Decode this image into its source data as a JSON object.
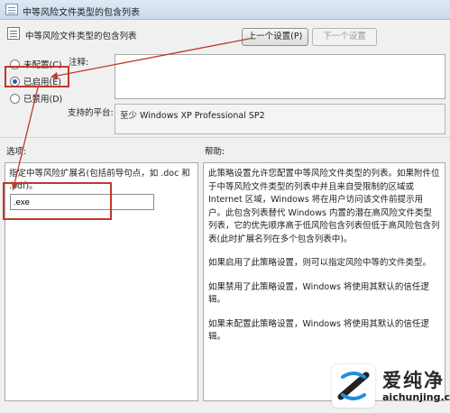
{
  "window": {
    "title": "中等风险文件类型的包含列表"
  },
  "header": {
    "title": "中等风险文件类型的包含列表"
  },
  "toolbar": {
    "prev_label": "上一个设置(P)",
    "next_label": "下一个设置"
  },
  "radios": {
    "not_configured": "未配置(C)",
    "enabled": "已启用(E)",
    "disabled": "已禁用(D)",
    "selected": "enabled"
  },
  "comment": {
    "label": "注释:",
    "value": ""
  },
  "platform": {
    "label": "支持的平台:",
    "value": "至少 Windows XP Professional SP2"
  },
  "sections": {
    "options": "选项:",
    "help": "帮助:"
  },
  "options": {
    "description": "指定中等风险扩展名(包括前导句点，如 .doc 和 .pdf)。",
    "extension_value": ".exe"
  },
  "help": {
    "paragraphs": [
      "此策略设置允许您配置中等风险文件类型的列表。如果附件位于中等风险文件类型的列表中并且来自受限制的区域或 Internet 区域，Windows 将在用户访问该文件前提示用户。此包含列表替代 Windows 内置的潜在高风险文件类型列表，它的优先顺序高于低风险包含列表但低于高风险包含列表(此时扩展名列在多个包含列表中)。",
      "如果启用了此策略设置，则可以指定风险中等的文件类型。",
      "如果禁用了此策略设置，Windows 将使用其默认的信任逻辑。",
      "如果未配置此策略设置，Windows 将使用其默认的信任逻辑。"
    ]
  },
  "watermark": {
    "name": "爱纯净",
    "url": "aichunjing.com"
  },
  "colors": {
    "highlight": "#c0392b",
    "selected_radio": "#2a5aa8"
  }
}
